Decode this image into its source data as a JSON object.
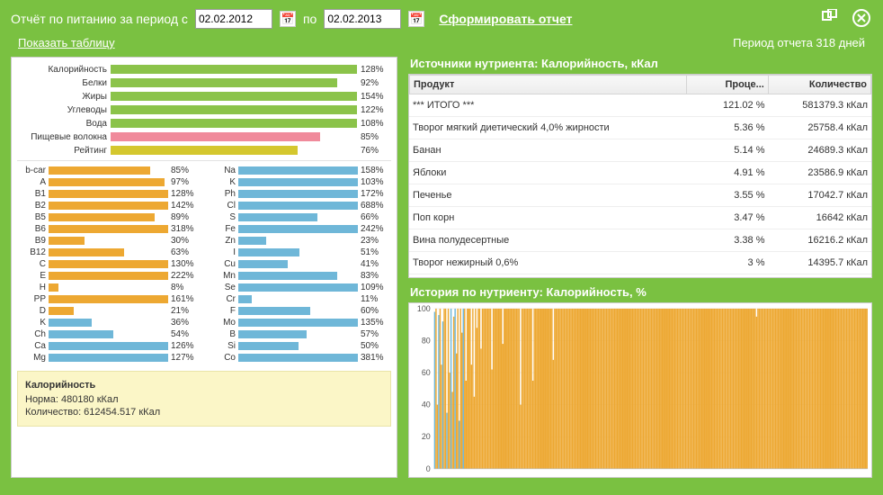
{
  "header": {
    "title": "Отчёт по питанию за период с",
    "date_from": "02.02.2012",
    "po": "по",
    "date_to": "02.02.2013",
    "generate": "Сформировать отчет"
  },
  "subheader": {
    "show_table": "Показать таблицу",
    "period": "Период отчета 318 дней"
  },
  "chart_data": {
    "nutrient_summary": {
      "type": "bar",
      "title": "",
      "ylim": [
        0,
        100
      ],
      "series": [
        {
          "name": "Калорийность",
          "value": 128,
          "color": "#8bc34a"
        },
        {
          "name": "Белки",
          "value": 92,
          "color": "#8bc34a"
        },
        {
          "name": "Жиры",
          "value": 154,
          "color": "#8bc34a"
        },
        {
          "name": "Углеводы",
          "value": 122,
          "color": "#8bc34a"
        },
        {
          "name": "Вода",
          "value": 108,
          "color": "#8bc34a"
        },
        {
          "name": "Пищевые волокна",
          "value": 85,
          "color": "#f08a9b"
        },
        {
          "name": "Рейтинг",
          "value": 76,
          "color": "#d4c72e"
        }
      ]
    },
    "micronutrients": {
      "type": "bar",
      "left": [
        {
          "name": "b-car",
          "value": 85,
          "color": "#eda832"
        },
        {
          "name": "A",
          "value": 97,
          "color": "#eda832"
        },
        {
          "name": "B1",
          "value": 128,
          "color": "#eda832"
        },
        {
          "name": "B2",
          "value": 142,
          "color": "#eda832"
        },
        {
          "name": "B5",
          "value": 89,
          "color": "#eda832"
        },
        {
          "name": "B6",
          "value": 318,
          "color": "#eda832"
        },
        {
          "name": "B9",
          "value": 30,
          "color": "#eda832"
        },
        {
          "name": "B12",
          "value": 63,
          "color": "#eda832"
        },
        {
          "name": "C",
          "value": 130,
          "color": "#eda832"
        },
        {
          "name": "E",
          "value": 222,
          "color": "#eda832"
        },
        {
          "name": "H",
          "value": 8,
          "color": "#eda832"
        },
        {
          "name": "PP",
          "value": 161,
          "color": "#eda832"
        },
        {
          "name": "D",
          "value": 21,
          "color": "#eda832"
        },
        {
          "name": "K",
          "value": 36,
          "color": "#6fb7d8"
        },
        {
          "name": "Ch",
          "value": 54,
          "color": "#6fb7d8"
        },
        {
          "name": "Ca",
          "value": 126,
          "color": "#6fb7d8"
        },
        {
          "name": "Mg",
          "value": 127,
          "color": "#6fb7d8"
        }
      ],
      "right": [
        {
          "name": "Na",
          "value": 158,
          "color": "#6fb7d8"
        },
        {
          "name": "K",
          "value": 103,
          "color": "#6fb7d8"
        },
        {
          "name": "Ph",
          "value": 172,
          "color": "#6fb7d8"
        },
        {
          "name": "Cl",
          "value": 688,
          "color": "#6fb7d8"
        },
        {
          "name": "S",
          "value": 66,
          "color": "#6fb7d8"
        },
        {
          "name": "Fe",
          "value": 242,
          "color": "#6fb7d8"
        },
        {
          "name": "Zn",
          "value": 23,
          "color": "#6fb7d8"
        },
        {
          "name": "I",
          "value": 51,
          "color": "#6fb7d8"
        },
        {
          "name": "Cu",
          "value": 41,
          "color": "#6fb7d8"
        },
        {
          "name": "Mn",
          "value": 83,
          "color": "#6fb7d8"
        },
        {
          "name": "Se",
          "value": 109,
          "color": "#6fb7d8"
        },
        {
          "name": "Cr",
          "value": 11,
          "color": "#6fb7d8"
        },
        {
          "name": "F",
          "value": 60,
          "color": "#6fb7d8"
        },
        {
          "name": "Mo",
          "value": 135,
          "color": "#6fb7d8"
        },
        {
          "name": "B",
          "value": 57,
          "color": "#6fb7d8"
        },
        {
          "name": "Si",
          "value": 50,
          "color": "#6fb7d8"
        },
        {
          "name": "Co",
          "value": 381,
          "color": "#6fb7d8"
        }
      ]
    },
    "history": {
      "type": "bar",
      "title": "История по нутриенту: Калорийность, %",
      "xlabel": "",
      "ylabel": "%",
      "ylim": [
        0,
        100
      ],
      "note": "318 daily values; most 95–100 with sporadic dips 20–80",
      "values": [
        98,
        100,
        40,
        96,
        100,
        65,
        92,
        100,
        100,
        35,
        100,
        60,
        100,
        48,
        95,
        100,
        72,
        100,
        30,
        100,
        85,
        100,
        100,
        55,
        100,
        100,
        100,
        65,
        100,
        45,
        100,
        88,
        100,
        100,
        75,
        100,
        100,
        100,
        100,
        100,
        100,
        100,
        62,
        100,
        100,
        100,
        100,
        100,
        100,
        100,
        78,
        100,
        100,
        100,
        100,
        100,
        100,
        100,
        100,
        100,
        100,
        100,
        100,
        40,
        100,
        100,
        100,
        100,
        100,
        100,
        100,
        100,
        55,
        100,
        100,
        100,
        100,
        100,
        100,
        100,
        100,
        100,
        100,
        100,
        100,
        100,
        100,
        68,
        100,
        100,
        100,
        100,
        100,
        100,
        100,
        100,
        100,
        100,
        100,
        100,
        100,
        100,
        100,
        100,
        100,
        100,
        100,
        100,
        100,
        100,
        100,
        100,
        100,
        100,
        100,
        100,
        100,
        100,
        100,
        100,
        100,
        100,
        100,
        100,
        100,
        100,
        100,
        100,
        100,
        100,
        100,
        100,
        100,
        100,
        100,
        100,
        100,
        100,
        100,
        100,
        100,
        100,
        100,
        100,
        100,
        100,
        100,
        100,
        100,
        100,
        100,
        100,
        100,
        100,
        100,
        100,
        100,
        100,
        100,
        100,
        100,
        100,
        100,
        100,
        100,
        100,
        100,
        100,
        100,
        100,
        100,
        100,
        100,
        100,
        100,
        100,
        100,
        100,
        100,
        100,
        100,
        100,
        100,
        100,
        100,
        100,
        100,
        100,
        100,
        100,
        100,
        100,
        100,
        100,
        100,
        100,
        100,
        100,
        100,
        100,
        100,
        100,
        100,
        100,
        100,
        100,
        100,
        100,
        100,
        100,
        100,
        100,
        100,
        100,
        100,
        100,
        100,
        100,
        100,
        100,
        100,
        100,
        100,
        100,
        100,
        100,
        100,
        100,
        100,
        100,
        100,
        100,
        100,
        100,
        100,
        100,
        95,
        100,
        100,
        100,
        100,
        100,
        100,
        100,
        100,
        100,
        100,
        100,
        100,
        100,
        100,
        100,
        100,
        100,
        100,
        100,
        100,
        100,
        100,
        100,
        100,
        100,
        100,
        100,
        100,
        100,
        100,
        100,
        100,
        100,
        100,
        100,
        100,
        100,
        100,
        100,
        100,
        100,
        100,
        100,
        100,
        100,
        100,
        100,
        100,
        100,
        100,
        100,
        100,
        100,
        100,
        100,
        100,
        100,
        100,
        100,
        100,
        100,
        100,
        100,
        100,
        100,
        100,
        100,
        100,
        100,
        100,
        100,
        100,
        100,
        100,
        100,
        100,
        100,
        100,
        100,
        100,
        100
      ]
    }
  },
  "info": {
    "title": "Калорийность",
    "norm": "Норма: 480180 кКал",
    "qty": "Количество: 612454.517 кКал"
  },
  "sources": {
    "title": "Источники нутриента: Калорийность, кКал",
    "columns": {
      "product": "Продукт",
      "pct": "Проце...",
      "qty": "Количество"
    },
    "rows": [
      {
        "product": "*** ИТОГО ***",
        "pct": "121.02 %",
        "qty": "581379.3 кКал"
      },
      {
        "product": "Творог мягкий диетический 4,0% жирности",
        "pct": "5.36 %",
        "qty": "25758.4 кКал"
      },
      {
        "product": "Банан",
        "pct": "5.14 %",
        "qty": "24689.3 кКал"
      },
      {
        "product": "Яблоки",
        "pct": "4.91 %",
        "qty": "23586.9 кКал"
      },
      {
        "product": "Печенье",
        "pct": "3.55 %",
        "qty": "17042.7 кКал"
      },
      {
        "product": "Поп корн",
        "pct": "3.47 %",
        "qty": "16642 кКал"
      },
      {
        "product": "Вина полудесертные",
        "pct": "3.38 %",
        "qty": "16216.2 кКал"
      },
      {
        "product": "Творог нежирный 0,6%",
        "pct": "3 %",
        "qty": "14395.7 кКал"
      }
    ]
  },
  "history_title": "История по нутриенту: Калорийность, %"
}
